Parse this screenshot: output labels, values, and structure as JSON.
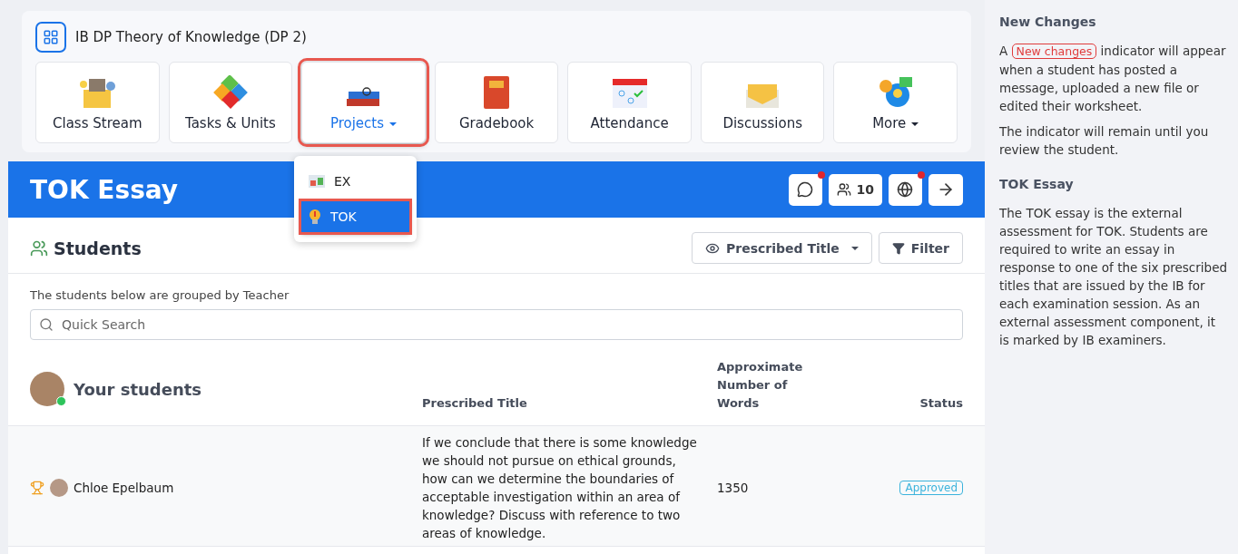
{
  "course": {
    "title": "IB DP Theory of Knowledge (DP 2)"
  },
  "nav": [
    {
      "label": "Class Stream",
      "selected": false,
      "dropdown": false
    },
    {
      "label": "Tasks & Units",
      "selected": false,
      "dropdown": false
    },
    {
      "label": "Projects",
      "selected": true,
      "dropdown": true
    },
    {
      "label": "Gradebook",
      "selected": false,
      "dropdown": false
    },
    {
      "label": "Attendance",
      "selected": false,
      "dropdown": false
    },
    {
      "label": "Discussions",
      "selected": false,
      "dropdown": false
    },
    {
      "label": "More",
      "selected": false,
      "dropdown": true
    }
  ],
  "projects_menu": [
    {
      "label": "EX",
      "selected": false
    },
    {
      "label": "TOK",
      "selected": true
    }
  ],
  "header": {
    "title": "TOK Essay",
    "student_count": "10",
    "chat_alert": true,
    "globe_alert": true
  },
  "students_panel": {
    "title": "Students",
    "view_button": "Prescribed Title",
    "filter_button": "Filter",
    "note": "The students below are grouped by Teacher",
    "search": {
      "placeholder": "Quick Search"
    }
  },
  "table": {
    "group": "Your students",
    "columns": [
      "Prescribed Title",
      "Approximate Number of Words",
      "Status"
    ],
    "rows": [
      {
        "name": "Chloe Epelbaum",
        "title": "If we conclude that there is some knowledge we should not pursue on ethical grounds, how can we determine the boundaries of acceptable investigation within an area of knowledge? Discuss with reference to two areas of knowledge.",
        "words": "1350",
        "status": "Approved"
      }
    ]
  },
  "help": [
    {
      "heading": "New Changes",
      "paragraphs": [
        {
          "before": "A",
          "badge": "New changes",
          "after": "indicator will appear when a student has posted a message, uploaded a new file or edited their worksheet."
        },
        {
          "before": "The indicator will remain until you review the student."
        }
      ]
    },
    {
      "heading": "TOK Essay",
      "paragraphs": [
        {
          "before": "The TOK essay is the external assessment for TOK. Students are required to write an essay in response to one of the six prescribed titles that are issued by the IB for each examination session. As an external assessment component, it is marked by IB examiners."
        }
      ]
    }
  ]
}
